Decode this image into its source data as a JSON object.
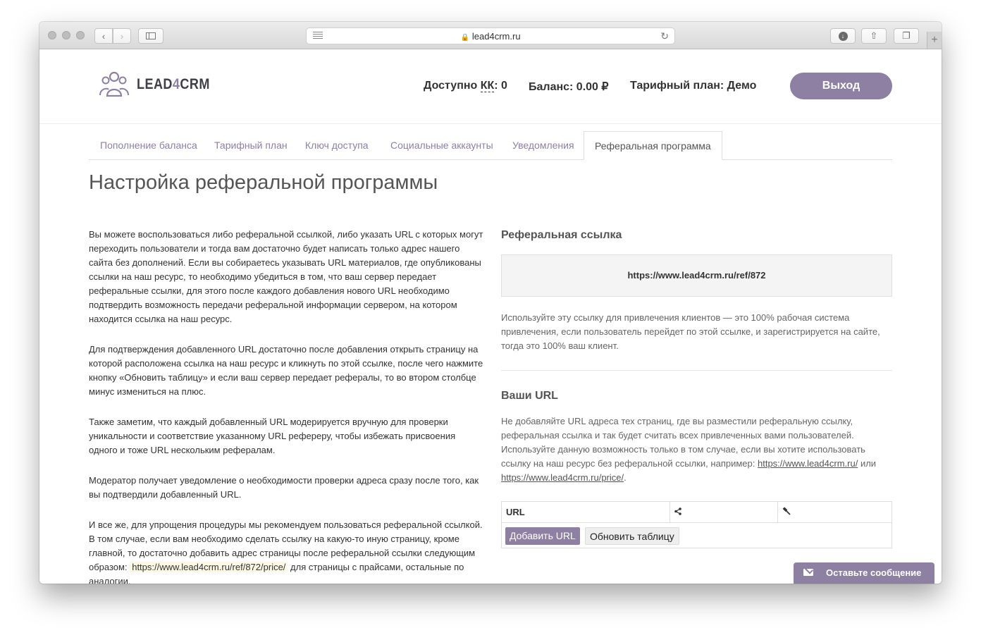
{
  "browser": {
    "url": "lead4crm.ru"
  },
  "header": {
    "logo_left": "LEAD",
    "logo_four": "4",
    "logo_right": "CRM",
    "kk_label": "Доступно",
    "kk_abbr": "КК",
    "kk_value": ": 0",
    "balance": "Баланс: 0.00 ₽",
    "plan": "Тарифный план: Демо",
    "logout": "Выход"
  },
  "tabs": [
    {
      "label": "Пополнение баланса"
    },
    {
      "label": "Тарифный план"
    },
    {
      "label": "Ключ доступа"
    },
    {
      "label": "Социальные аккаунты"
    },
    {
      "label": "Уведомления"
    },
    {
      "label": "Реферальная программа",
      "active": true
    }
  ],
  "page_title": "Настройка реферальной программы",
  "left": {
    "p1": "Вы можете воспользоваться либо реферальной ссылкой, либо указать URL с которых могут переходить пользователи и тогда вам достаточно будет написать только адрес нашего сайта без дополнений. Если вы собираетесь указывать URL материалов, где опубликованы ссылки на наш ресурс, то необходимо убедиться в том, что ваш сервер передает реферальные ссылки, для этого после каждого добавления нового URL необходимо подтвердить возможность передачи реферальной информации сервером, на котором находится ссылка на наш ресурс.",
    "p2": "Для подтверждения добавленного URL достаточно после добавления открыть страницу на которой расположена ссылка на наш ресурс и кликнуть по этой ссылке, после чего нажмите кнопку «Обновить таблицу» и если ваш сервер передает рефералы, то во втором столбце минус измениться на плюс.",
    "p3": "Также заметим, что каждый добавленный URL модерируется вручную для проверки уникальности и соответствие указанному URL рефереру, чтобы избежать присвоения одного и тоже URL нескольким рефералам.",
    "p4": "Модератор получает уведомление о необходимости проверки адреса сразу после того, как вы подтвердили добавленный URL.",
    "p5_start": "И все же, для упрощения процедуры мы рекомендуем пользоваться реферальной ссылкой. В том случае, если вам необходимо сделать ссылку на какую-то иную страницу, кроме главной, то достаточно добавить адрес страницы после реферальной ссылки следующим образом:",
    "p5_code": "https://www.lead4crm.ru/ref/872/price/",
    "p5_end": "для страницы с прайсами, остальные по аналогии."
  },
  "right": {
    "ref_title": "Реферальная ссылка",
    "ref_link": "https://www.lead4crm.ru/ref/872",
    "ref_desc": "Используйте эту ссылку для привлечения клиентов — это 100% рабочая система привлечения, если пользователь перейдет по этой ссылке, и зарегистрируется на сайте, тогда это 100% ваш клиент.",
    "urls_title": "Ваши URL",
    "urls_desc": "Не добавляйте URL адреса тех страниц, где вы разместили реферальную ссылку, реферальная ссылка и так будет считать всех привлеченных вами пользователей. Используйте данную возможность только в том случае, если вы хотите использовать ссылку на наш ресурс без реферальной ссылки, например:",
    "example1": "https://www.lead4crm.ru/",
    "or": "или",
    "example2": "https://www.lead4crm.ru/price/",
    "table_col_url": "URL",
    "btn_add": "Добавить URL",
    "btn_refresh": "Обновить таблицу"
  },
  "chat": {
    "label": "Оставьте сообщение"
  }
}
